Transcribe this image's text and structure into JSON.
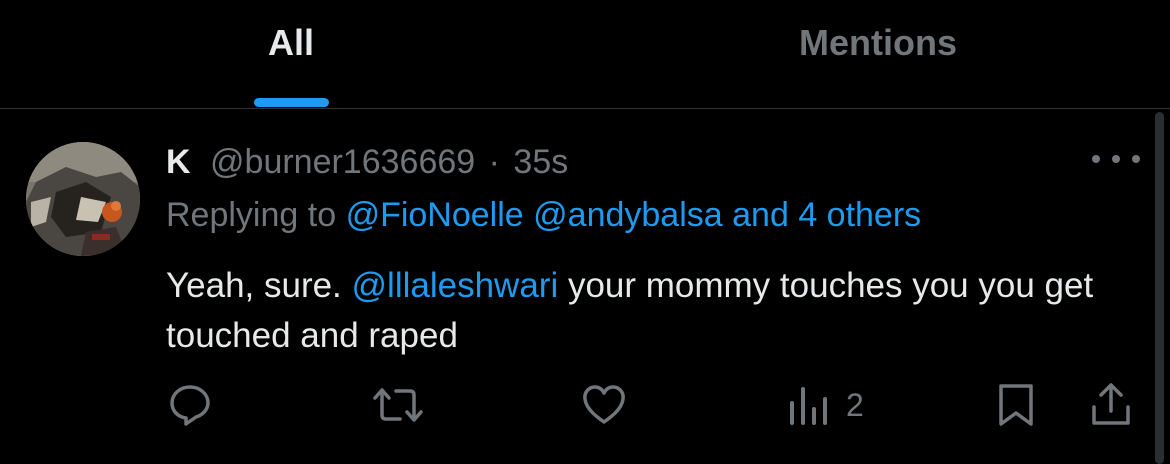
{
  "tabs": [
    {
      "label": "All"
    },
    {
      "label": "Mentions"
    }
  ],
  "tweet": {
    "name": "K",
    "handle": "@burner1636669",
    "separator": "·",
    "time": "35s",
    "replying_prefix": "Replying to",
    "replying_to": [
      "@FioNoelle",
      "@andybalsa"
    ],
    "replying_others": "and 4 others",
    "text_before": "Yeah, sure. ",
    "mention": "@lllaleshwari",
    "text_after": " your mommy touches you you get touched and raped",
    "views": "2"
  },
  "icons": {
    "reply": "reply-icon",
    "retweet": "retweet-icon",
    "like": "heart-icon",
    "views": "views-chart-icon",
    "bookmark": "bookmark-icon",
    "share": "share-icon",
    "more": "more-dots-icon"
  },
  "colors": {
    "accent": "#1d9bf0",
    "muted": "#71767b",
    "text": "#e7e9ea",
    "background": "#000000"
  }
}
